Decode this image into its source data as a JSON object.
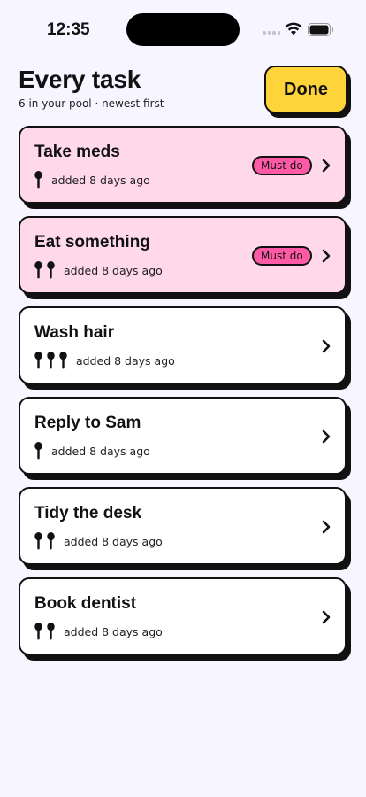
{
  "status_bar": {
    "time": "12:35"
  },
  "header": {
    "title": "Every task",
    "subtitle": "6 in your pool · newest first",
    "done_label": "Done"
  },
  "tasks": [
    {
      "title": "Take meds",
      "spoons": 1,
      "age": "added 8 days ago",
      "must_do": true,
      "badge": "Must do"
    },
    {
      "title": "Eat something",
      "spoons": 2,
      "age": "added 8 days ago",
      "must_do": true,
      "badge": "Must do"
    },
    {
      "title": "Wash hair",
      "spoons": 3,
      "age": "added 8 days ago",
      "must_do": false
    },
    {
      "title": "Reply to Sam",
      "spoons": 1,
      "age": "added 8 days ago",
      "must_do": false
    },
    {
      "title": "Tidy the desk",
      "spoons": 2,
      "age": "added 8 days ago",
      "must_do": false
    },
    {
      "title": "Book dentist",
      "spoons": 2,
      "age": "added 8 days ago",
      "must_do": false
    }
  ],
  "icons": {
    "spoon": "spoon-icon",
    "chevron": "chevron-right-icon"
  },
  "colors": {
    "background": "#f7f5ff",
    "must_card": "#ffd9ea",
    "must_badge": "#ff5aa5",
    "done_button": "#ffd43b",
    "outline": "#111111"
  }
}
